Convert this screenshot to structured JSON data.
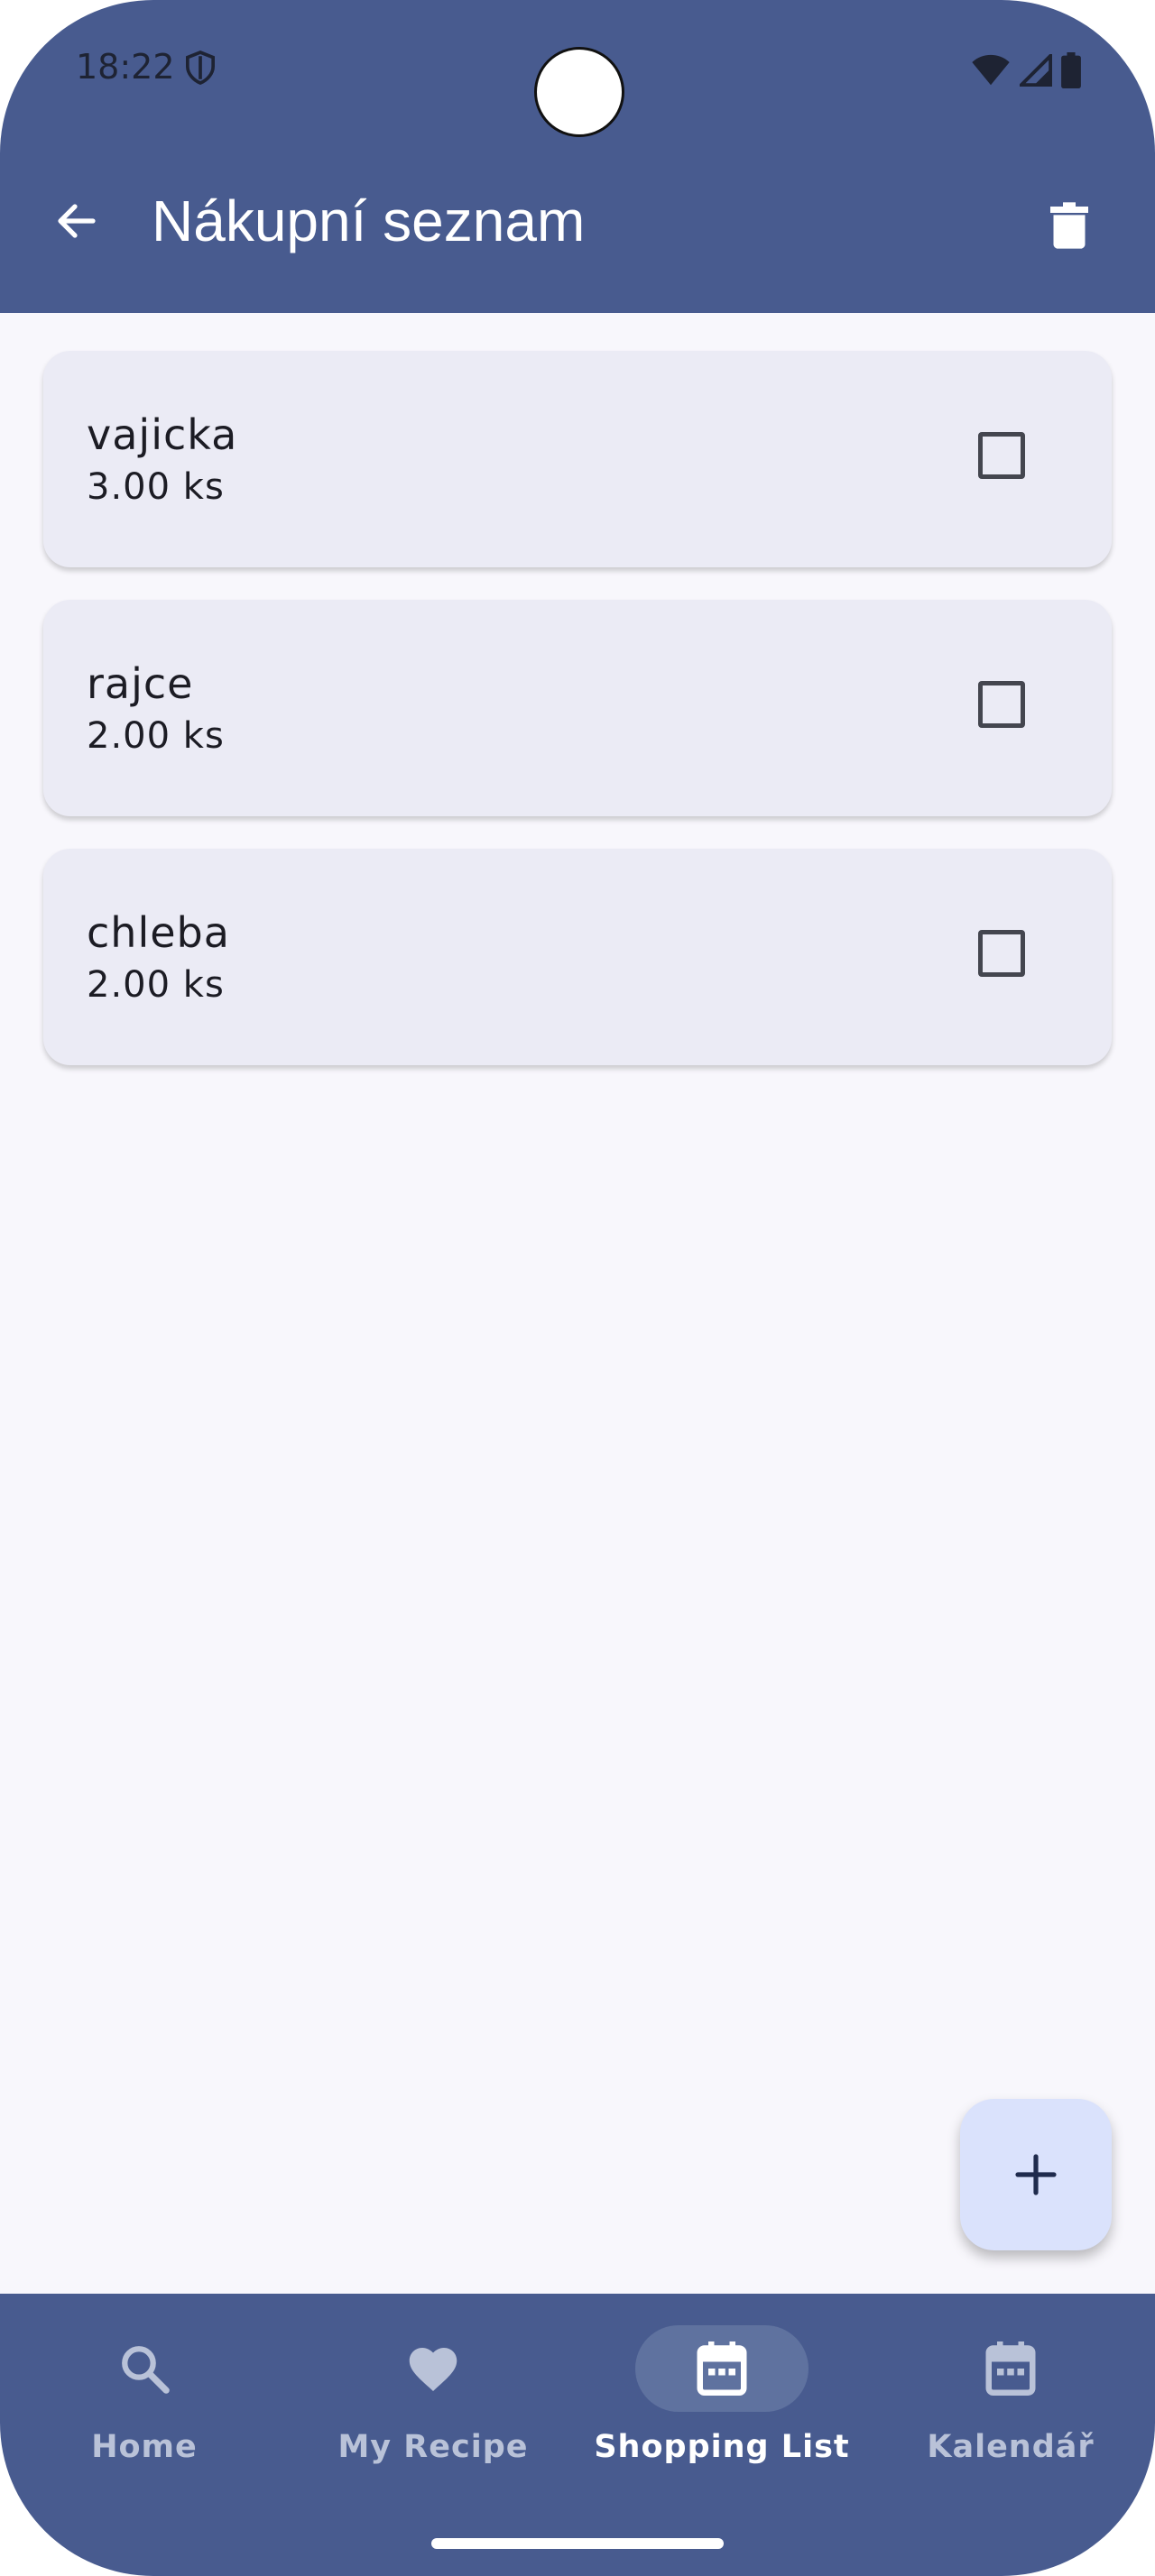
{
  "status_bar": {
    "time": "18:22"
  },
  "app_bar": {
    "title": "Nákupní seznam"
  },
  "items": [
    {
      "name": "vajicka",
      "quantity": "3.00 ks",
      "checked": false
    },
    {
      "name": "rajce",
      "quantity": "2.00 ks",
      "checked": false
    },
    {
      "name": "chleba",
      "quantity": "2.00 ks",
      "checked": false
    }
  ],
  "nav": [
    {
      "label": "Home",
      "icon": "search-icon",
      "active": false
    },
    {
      "label": "My Recipe",
      "icon": "heart-icon",
      "active": false
    },
    {
      "label": "Shopping List",
      "icon": "calendar-icon",
      "active": true
    },
    {
      "label": "Kalendář",
      "icon": "calendar-icon",
      "active": false
    }
  ],
  "colors": {
    "primary": "#485b8f",
    "background": "#f8f7fc",
    "card": "#ebebf5",
    "fab": "#dae2fc"
  }
}
